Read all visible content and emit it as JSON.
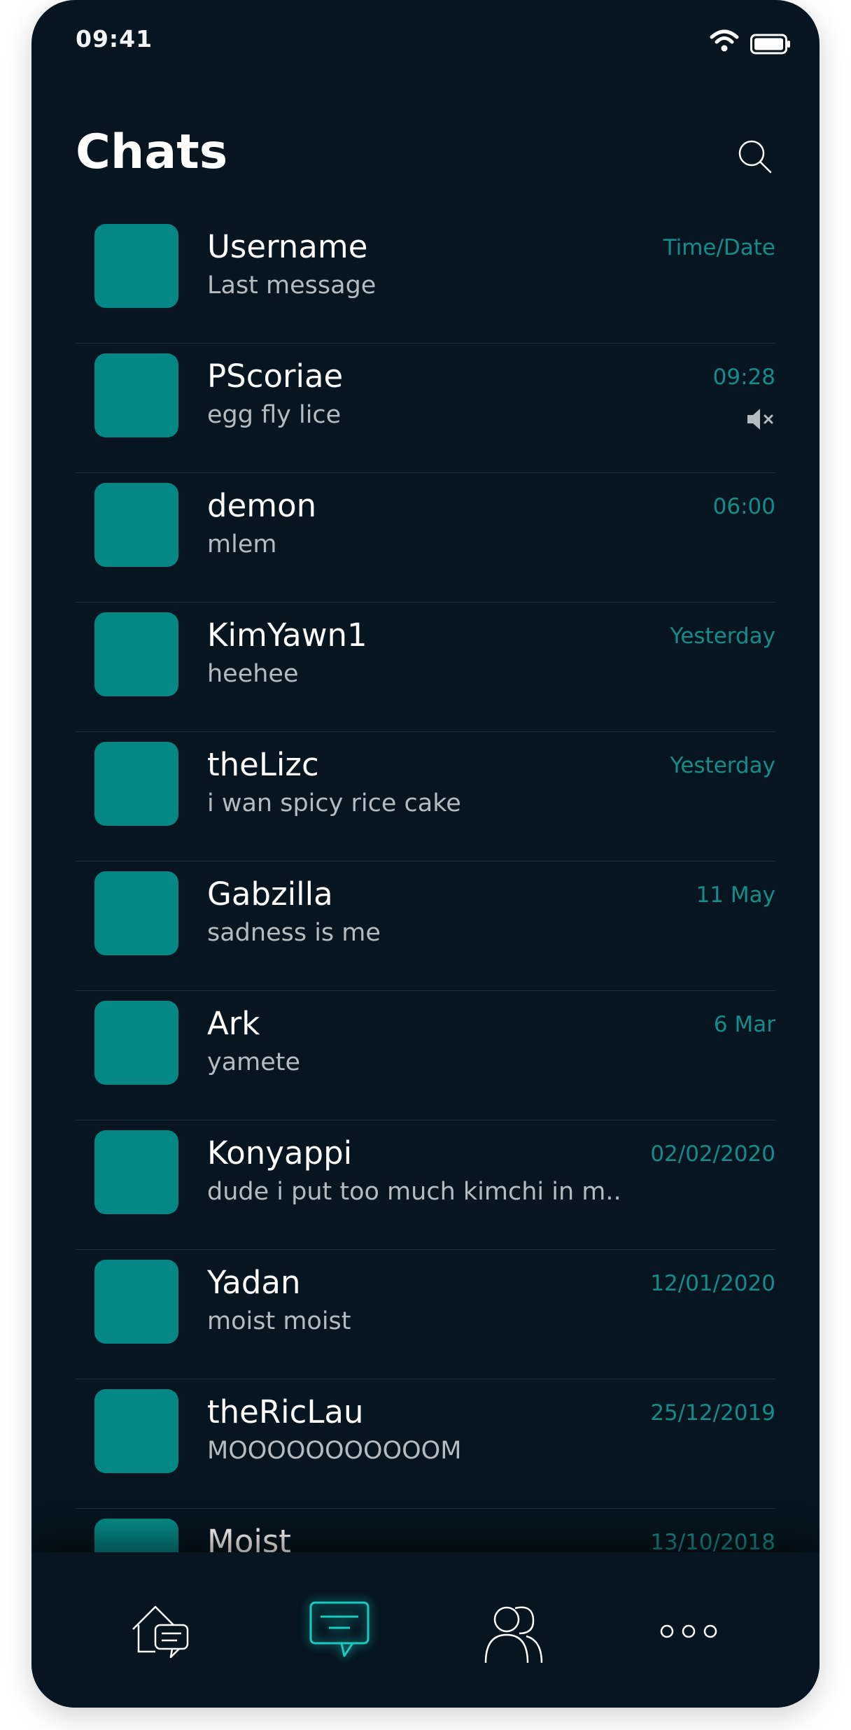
{
  "status_bar": {
    "time": "09:41"
  },
  "header": {
    "title": "Chats"
  },
  "chats": [
    {
      "username": "Username",
      "last_message": "Last message",
      "time": "Time/Date",
      "muted": false
    },
    {
      "username": "PScoriae",
      "last_message": "egg fly lice",
      "time": "09:28",
      "muted": true
    },
    {
      "username": "demon",
      "last_message": "mlem",
      "time": "06:00",
      "muted": false
    },
    {
      "username": "KimYawn1",
      "last_message": "heehee",
      "time": "Yesterday",
      "muted": false
    },
    {
      "username": "theLizc",
      "last_message": "i wan spicy rice cake",
      "time": "Yesterday",
      "muted": false
    },
    {
      "username": "Gabzilla",
      "last_message": "sadness is me",
      "time": "11 May",
      "muted": false
    },
    {
      "username": "Ark",
      "last_message": "yamete",
      "time": "6 Mar",
      "muted": false
    },
    {
      "username": "Konyappi",
      "last_message": "dude i put too much kimchi in m..",
      "time": "02/02/2020",
      "muted": false
    },
    {
      "username": "Yadan",
      "last_message": "moist moist",
      "time": "12/01/2020",
      "muted": false
    },
    {
      "username": "theRicLau",
      "last_message": "MOOOOOOOOOOOM",
      "time": "25/12/2019",
      "muted": false
    },
    {
      "username": "Moist",
      "last_message": "",
      "time": "13/10/2018",
      "muted": false
    }
  ],
  "nav": {
    "items": [
      "home-chat-icon",
      "chats-icon",
      "contacts-icon",
      "more-icon"
    ],
    "active": "chats-icon"
  },
  "colors": {
    "background": "#06151f",
    "accent": "#048785",
    "accent_text": "#138c8a",
    "active_nav": "#19c9c2"
  }
}
